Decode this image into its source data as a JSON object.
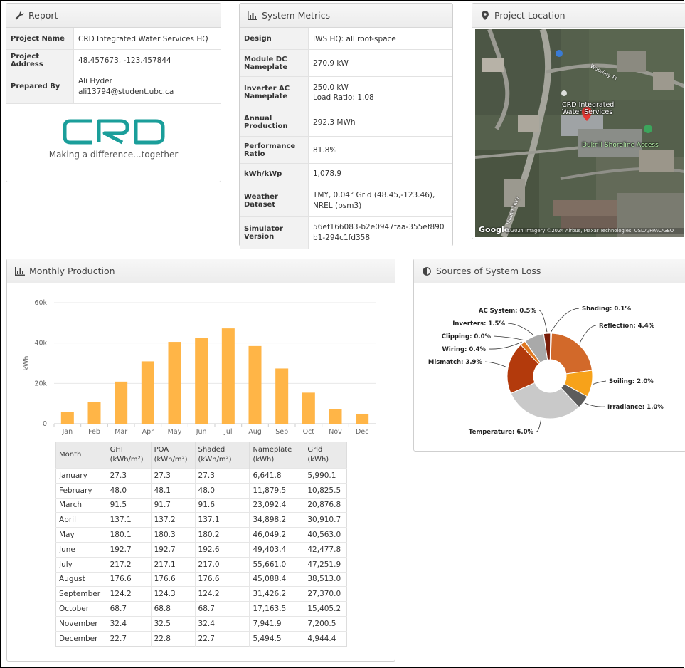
{
  "report": {
    "title": "Report",
    "rows": [
      {
        "label": "Project Name",
        "value": "CRD Integrated Water Services HQ"
      },
      {
        "label": "Project Address",
        "value": "48.457673, -123.457844"
      },
      {
        "label": "Prepared By",
        "value": "Ali Hyder",
        "value2": "ali13794@student.ubc.ca"
      }
    ],
    "logo_text": "CRD",
    "tagline": "Making a difference...together",
    "logo_color": "#1a9e9a"
  },
  "metrics": {
    "title": "System Metrics",
    "rows": [
      {
        "label": "Design",
        "value": "IWS HQ: all roof-space"
      },
      {
        "label": "Module DC Nameplate",
        "value": "270.9 kW"
      },
      {
        "label": "Inverter AC Nameplate",
        "value": "250.0 kW",
        "value2": "Load Ratio: 1.08"
      },
      {
        "label": "Annual Production",
        "value": "292.3 MWh"
      },
      {
        "label": "Performance Ratio",
        "value": "81.8%"
      },
      {
        "label": "kWh/kWp",
        "value": "1,078.9"
      },
      {
        "label": "Weather Dataset",
        "value": "TMY, 0.04° Grid (48.45,-123.46), NREL (psm3)"
      },
      {
        "label": "Simulator Version",
        "value": "56ef166083-b2e0947faa-355ef890b1-294c1fd358"
      }
    ]
  },
  "location": {
    "title": "Project Location",
    "place_label": "CRD Integrated Water Services",
    "poi_label": "Dukrill Shoreline Access",
    "road_label_1": "Woodley Pl",
    "road_label_2": "Island Hwy",
    "google": "Google",
    "attribution": "©2024 Imagery ©2024 Airbus, Maxar Technologies, USDA/FPAC/GEO"
  },
  "monthly": {
    "title": "Monthly Production",
    "table_headers": [
      {
        "l1": "Month",
        "l2": ""
      },
      {
        "l1": "GHI",
        "l2": "(kWh/m²)"
      },
      {
        "l1": "POA",
        "l2": "(kWh/m²)"
      },
      {
        "l1": "Shaded",
        "l2": "(kWh/m²)"
      },
      {
        "l1": "Nameplate",
        "l2": "(kWh)"
      },
      {
        "l1": "Grid",
        "l2": "(kWh)"
      }
    ],
    "rows": [
      [
        "January",
        "27.3",
        "27.3",
        "27.3",
        "6,641.8",
        "5,990.1"
      ],
      [
        "February",
        "48.0",
        "48.1",
        "48.0",
        "11,879.5",
        "10,825.5"
      ],
      [
        "March",
        "91.5",
        "91.7",
        "91.6",
        "23,092.4",
        "20,876.8"
      ],
      [
        "April",
        "137.1",
        "137.2",
        "137.1",
        "34,898.2",
        "30,910.7"
      ],
      [
        "May",
        "180.1",
        "180.3",
        "180.2",
        "46,049.2",
        "40,563.0"
      ],
      [
        "June",
        "192.7",
        "192.7",
        "192.6",
        "49,403.4",
        "42,477.8"
      ],
      [
        "July",
        "217.2",
        "217.1",
        "217.0",
        "55,661.0",
        "47,251.9"
      ],
      [
        "August",
        "176.6",
        "176.6",
        "176.6",
        "45,088.4",
        "38,513.0"
      ],
      [
        "September",
        "124.2",
        "124.3",
        "124.2",
        "31,426.2",
        "27,370.0"
      ],
      [
        "October",
        "68.7",
        "68.8",
        "68.7",
        "17,163.5",
        "15,405.2"
      ],
      [
        "November",
        "32.4",
        "32.5",
        "32.4",
        "7,941.9",
        "7,200.5"
      ],
      [
        "December",
        "22.7",
        "22.8",
        "22.7",
        "5,494.5",
        "4,944.4"
      ]
    ]
  },
  "loss": {
    "title": "Sources of System Loss"
  },
  "chart_data": [
    {
      "type": "bar",
      "categories": [
        "Jan",
        "Feb",
        "Mar",
        "Apr",
        "May",
        "Jun",
        "Jul",
        "Aug",
        "Sep",
        "Oct",
        "Nov",
        "Dec"
      ],
      "values": [
        5990.1,
        10825.5,
        20876.8,
        30910.7,
        40563.0,
        42477.8,
        47251.9,
        38513.0,
        27370.0,
        15405.2,
        7200.5,
        4944.4
      ],
      "ylabel": "kWh",
      "ylim": [
        0,
        60000
      ],
      "yticks": [
        "0",
        "20k",
        "40k",
        "60k"
      ],
      "grid": true,
      "color": "#ffb547"
    },
    {
      "type": "pie",
      "donut": true,
      "slices": [
        {
          "label": "Shading: 0.1%",
          "value": 0.1,
          "color": "#9a2a10"
        },
        {
          "label": "Reflection: 4.4%",
          "value": 4.4,
          "color": "#d2692a"
        },
        {
          "label": "Soiling: 2.0%",
          "value": 2.0,
          "color": "#f7a21a"
        },
        {
          "label": "Irradiance: 1.0%",
          "value": 1.0,
          "color": "#5c5c5c"
        },
        {
          "label": "Temperature: 6.0%",
          "value": 6.0,
          "color": "#c9c9c9"
        },
        {
          "label": "Mismatch: 3.9%",
          "value": 3.9,
          "color": "#b33a0c"
        },
        {
          "label": "Wiring: 0.4%",
          "value": 0.4,
          "color": "#e07820"
        },
        {
          "label": "Clipping: 0.0%",
          "value": 0.0,
          "color": "#888888"
        },
        {
          "label": "Inverters: 1.5%",
          "value": 1.5,
          "color": "#a9a9a9"
        },
        {
          "label": "AC System: 0.5%",
          "value": 0.5,
          "color": "#7a1d08"
        }
      ]
    }
  ]
}
